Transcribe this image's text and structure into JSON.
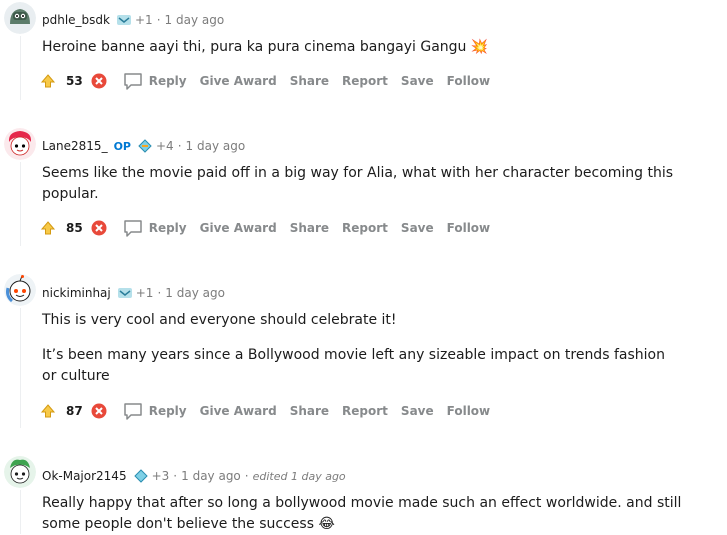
{
  "comments": [
    {
      "username": "pdhle_bsdk",
      "is_op": false,
      "op_label": "",
      "karma": "+1",
      "time": "1 day ago",
      "edited": "",
      "paragraphs": [
        "Heroine banne aayi thi, pura ka pura cinema bangayi Gangu 💥"
      ],
      "score": "53",
      "actions": {
        "reply": "Reply",
        "give_award": "Give Award",
        "share": "Share",
        "report": "Report",
        "save": "Save",
        "follow": "Follow"
      }
    },
    {
      "username": "Lane2815_",
      "is_op": true,
      "op_label": "OP",
      "karma": "+4",
      "time": "1 day ago",
      "edited": "",
      "paragraphs": [
        "Seems like the movie paid off in a big way for Alia, what with her character becoming this popular."
      ],
      "score": "85",
      "actions": {
        "reply": "Reply",
        "give_award": "Give Award",
        "share": "Share",
        "report": "Report",
        "save": "Save",
        "follow": "Follow"
      }
    },
    {
      "username": "nickiminhaj",
      "is_op": false,
      "op_label": "",
      "karma": "+1",
      "time": "1 day ago",
      "edited": "",
      "paragraphs": [
        "This is very cool and everyone should celebrate it!",
        "It’s been many years since a Bollywood movie left any sizeable impact on trends fashion or culture"
      ],
      "score": "87",
      "actions": {
        "reply": "Reply",
        "give_award": "Give Award",
        "share": "Share",
        "report": "Report",
        "save": "Save",
        "follow": "Follow"
      }
    },
    {
      "username": "Ok-Major2145",
      "is_op": false,
      "op_label": "",
      "karma": "+3",
      "time": "1 day ago",
      "edited": "edited 1 day ago",
      "paragraphs": [
        "Really happy that after so long a bollywood movie made such an effect worldwide. and still some people don't believe the success 😂"
      ],
      "score": "",
      "actions": {}
    }
  ]
}
